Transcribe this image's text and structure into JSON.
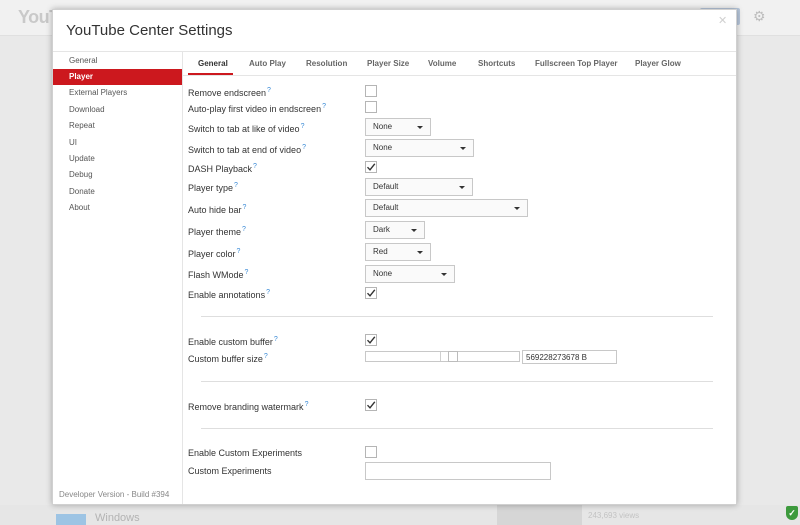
{
  "background": {
    "logo_text": "YouTube",
    "windows_label": "Windows",
    "views_text": "243,693 views"
  },
  "dialog": {
    "title": "YouTube Center Settings",
    "close_glyph": "✕"
  },
  "sidebar": {
    "items": [
      {
        "label": "General"
      },
      {
        "label": "Player"
      },
      {
        "label": "External Players"
      },
      {
        "label": "Download"
      },
      {
        "label": "Repeat"
      },
      {
        "label": "UI"
      },
      {
        "label": "Update"
      },
      {
        "label": "Debug"
      },
      {
        "label": "Donate"
      },
      {
        "label": "About"
      }
    ],
    "active": "Player",
    "footer": "Developer Version - Build #394"
  },
  "tabs": {
    "items": [
      {
        "label": "General"
      },
      {
        "label": "Auto Play"
      },
      {
        "label": "Resolution"
      },
      {
        "label": "Player Size"
      },
      {
        "label": "Volume"
      },
      {
        "label": "Shortcuts"
      },
      {
        "label": "Fullscreen Top Player"
      },
      {
        "label": "Player Glow"
      }
    ],
    "active": "General"
  },
  "help_glyph": "?",
  "settings": {
    "remove_endscreen": {
      "label": "Remove endscreen",
      "checked": false
    },
    "autoplay_endscreen": {
      "label": "Auto-play first video in endscreen",
      "checked": false
    },
    "switch_like": {
      "label": "Switch to tab at like of video",
      "value": "None"
    },
    "switch_end": {
      "label": "Switch to tab at end of video",
      "value": "None"
    },
    "dash_playback": {
      "label": "DASH Playback",
      "checked": true
    },
    "player_type": {
      "label": "Player type",
      "value": "Default"
    },
    "auto_hide_bar": {
      "label": "Auto hide bar",
      "value": "Default"
    },
    "player_theme": {
      "label": "Player theme",
      "value": "Dark"
    },
    "player_color": {
      "label": "Player color",
      "value": "Red"
    },
    "flash_wmode": {
      "label": "Flash WMode",
      "value": "None"
    },
    "enable_annotations": {
      "label": "Enable annotations",
      "checked": true
    },
    "enable_custom_buffer": {
      "label": "Enable custom buffer",
      "checked": true
    },
    "custom_buffer_size": {
      "label": "Custom buffer size",
      "value": "569228273678 B"
    },
    "remove_branding": {
      "label": "Remove branding watermark",
      "checked": true
    },
    "enable_experiments": {
      "label": "Enable Custom Experiments",
      "checked": false
    },
    "custom_experiments": {
      "label": "Custom Experiments",
      "value": ""
    }
  },
  "colors": {
    "accent": "#cc181e",
    "help": "#3a8ad6"
  }
}
